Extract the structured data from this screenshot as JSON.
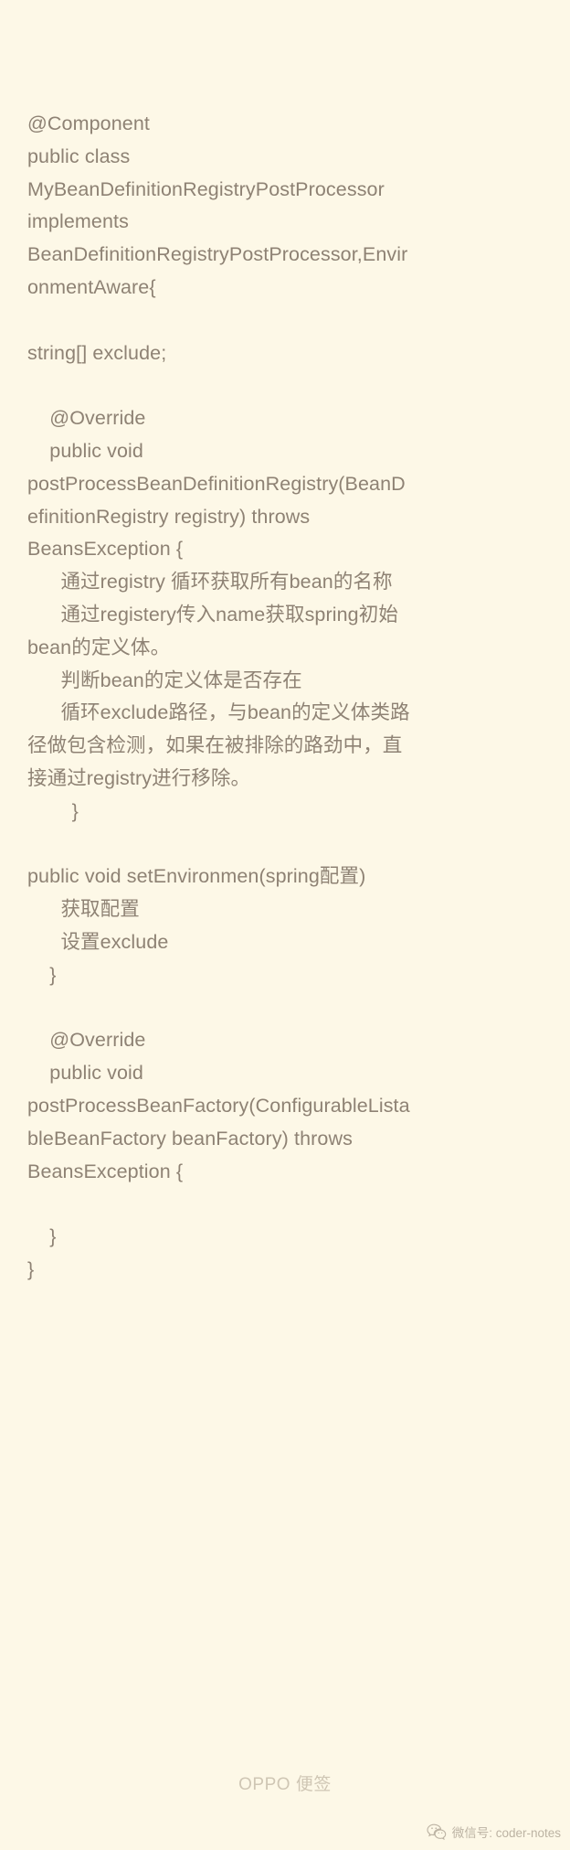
{
  "note": {
    "background_color": "#fdf8e7",
    "text_color": "#8e8274",
    "lines": [
      "@Component",
      "public class",
      "MyBeanDefinitionRegistryPostProcessor",
      "implements",
      "BeanDefinitionRegistryPostProcessor,Envir",
      "onmentAware{",
      "",
      "string[] exclude;",
      "",
      "    @Override",
      "    public void",
      "postProcessBeanDefinitionRegistry(BeanD",
      "efinitionRegistry registry) throws",
      "BeansException {",
      "      通过registry 循环获取所有bean的名称",
      "      通过registery传入name获取spring初始",
      "bean的定义体。",
      "      判断bean的定义体是否存在",
      "      循环exclude路径，与bean的定义体类路",
      "径做包含检测，如果在被排除的路劲中，直",
      "接通过registry进行移除。",
      "        }",
      "",
      "public void setEnvironmen(spring配置)",
      "      获取配置",
      "      设置exclude",
      "    }",
      "",
      "    @Override",
      "    public void",
      "postProcessBeanFactory(ConfigurableLista",
      "bleBeanFactory beanFactory) throws",
      "BeansException {",
      "",
      "    }",
      "}"
    ]
  },
  "footer": {
    "brand_label": "OPPO 便签"
  },
  "watermark": {
    "icon": "wechat-icon",
    "label": "微信号: coder-notes"
  }
}
